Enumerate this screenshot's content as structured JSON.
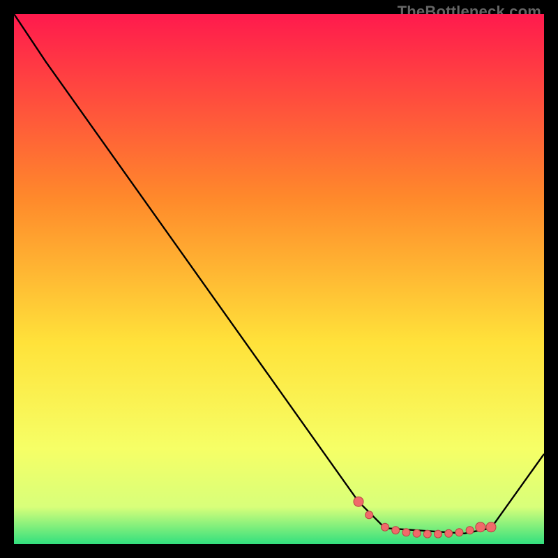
{
  "watermark": "TheBottleneck.com",
  "colors": {
    "bg_black": "#000000",
    "grad_top": "#ff1a4d",
    "grad_mid1": "#ff8a2b",
    "grad_mid2": "#ffe23a",
    "grad_low1": "#f6ff66",
    "grad_low2": "#d8ff7a",
    "grad_bottom": "#32e07e",
    "curve": "#000000",
    "marker_fill": "#f06a6a",
    "marker_stroke": "#b74343"
  },
  "chart_data": {
    "type": "line",
    "title": "",
    "xlabel": "",
    "ylabel": "",
    "xlim": [
      0,
      100
    ],
    "ylim": [
      0,
      100
    ],
    "grid": false,
    "legend": false,
    "series": [
      {
        "name": "curve",
        "x": [
          0,
          6,
          65,
          70,
          85,
          90,
          100
        ],
        "y": [
          100,
          91,
          8,
          3,
          2,
          3,
          17
        ]
      }
    ],
    "markers": {
      "name": "highlight",
      "x": [
        65,
        67,
        70,
        72,
        74,
        76,
        78,
        80,
        82,
        84,
        86,
        88,
        90
      ],
      "y": [
        8,
        5.5,
        3.2,
        2.6,
        2.2,
        2.0,
        1.9,
        1.9,
        2.0,
        2.2,
        2.6,
        3.2,
        3.2
      ]
    }
  }
}
